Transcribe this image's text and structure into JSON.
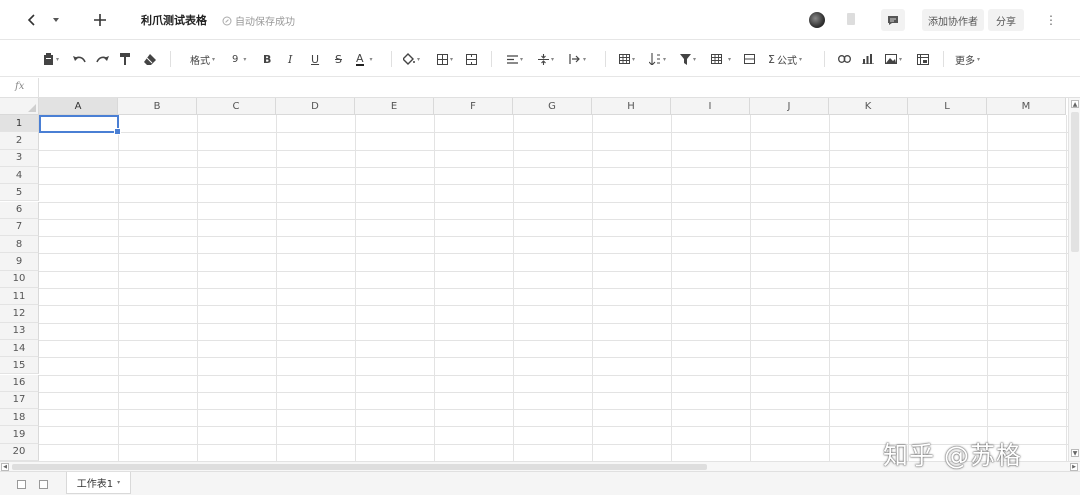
{
  "header": {
    "title": "利爪测试表格",
    "save_status": "自动保存成功",
    "add_collaborator": "添加协作者",
    "share": "分享"
  },
  "toolbar": {
    "format_label": "格式",
    "font_size": "9",
    "bold": "B",
    "italic": "I",
    "underline": "U",
    "strike": "S",
    "font_color": "A",
    "formula_label": "公式",
    "sigma": "Σ",
    "more_label": "更多"
  },
  "formula_bar": {
    "fx": "fx"
  },
  "grid": {
    "columns": [
      "A",
      "B",
      "C",
      "D",
      "E",
      "F",
      "G",
      "H",
      "I",
      "J",
      "K",
      "L",
      "M"
    ],
    "rows": [
      "1",
      "2",
      "3",
      "4",
      "5",
      "6",
      "7",
      "8",
      "9",
      "10",
      "11",
      "12",
      "13",
      "14",
      "15",
      "16",
      "17",
      "18",
      "19",
      "20"
    ],
    "selected_cell": "A1"
  },
  "sheets": {
    "tabs": [
      {
        "label": "工作表1"
      }
    ]
  },
  "watermark": "知乎 @苏格"
}
